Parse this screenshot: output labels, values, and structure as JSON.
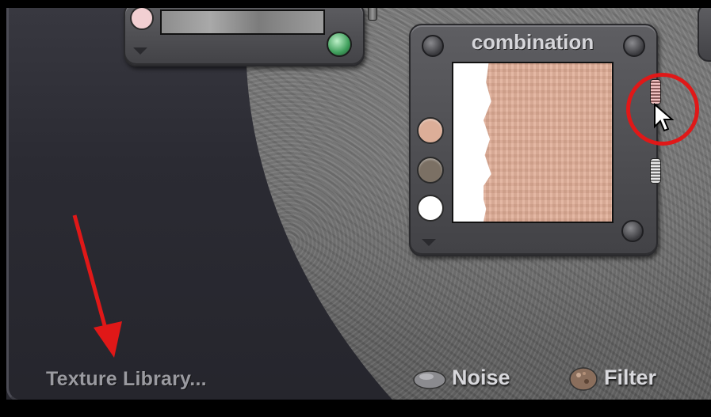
{
  "left_panel": {
    "texture_library_label": "Texture Library..."
  },
  "nodes": {
    "combination": {
      "title": "combination",
      "swatches": [
        {
          "name": "skin-swatch",
          "color": "#dcae98"
        },
        {
          "name": "brown-swatch",
          "color": "#7b7064"
        },
        {
          "name": "white-swatch",
          "color": "#ffffff"
        }
      ]
    },
    "upper_node": {
      "swatch_color": "#f2cfd2",
      "knob_color": "#3e9e5b"
    }
  },
  "toolbar": {
    "noise_label": "Noise",
    "filter_label": "Filter"
  },
  "annotation_colors": {
    "highlight": "#e01818"
  }
}
